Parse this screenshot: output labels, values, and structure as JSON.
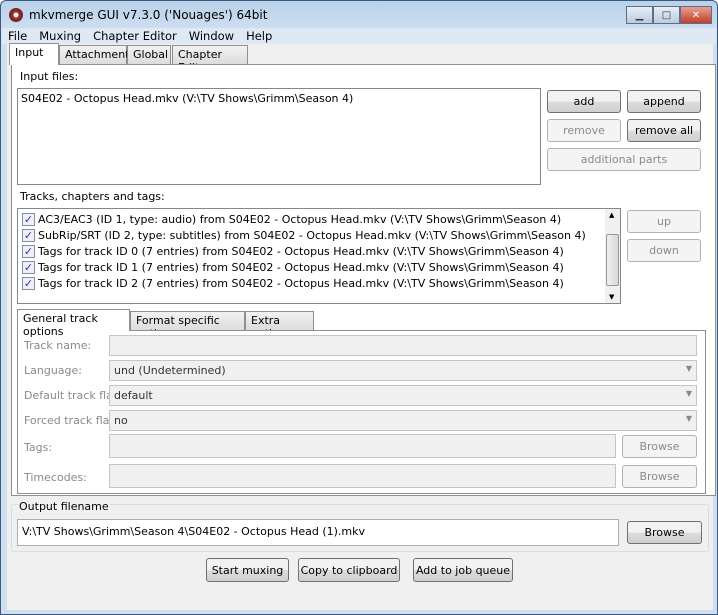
{
  "window": {
    "title": "mkvmerge GUI v7.3.0 ('Nouages') 64bit",
    "minimize": "▁",
    "maximize": "□",
    "close": "✕"
  },
  "menu": [
    "File",
    "Muxing",
    "Chapter Editor",
    "Window",
    "Help"
  ],
  "tabs": [
    "Input",
    "Attachments",
    "Global",
    "Chapter Editor"
  ],
  "input": {
    "input_files_label": "Input files:",
    "files": [
      "S04E02 - Octopus Head.mkv (V:\\TV Shows\\Grimm\\Season 4)"
    ],
    "add": "add",
    "append": "append",
    "remove": "remove",
    "remove_all": "remove all",
    "additional_parts": "additional parts",
    "tracks_label": "Tracks, chapters and tags:",
    "tracks": [
      "AC3/EAC3 (ID 1, type: audio) from S04E02 - Octopus Head.mkv (V:\\TV Shows\\Grimm\\Season 4)",
      "SubRip/SRT (ID 2, type: subtitles) from S04E02 - Octopus Head.mkv (V:\\TV Shows\\Grimm\\Season 4)",
      "Tags for track ID 0 (7 entries) from S04E02 - Octopus Head.mkv (V:\\TV Shows\\Grimm\\Season 4)",
      "Tags for track ID 1 (7 entries) from S04E02 - Octopus Head.mkv (V:\\TV Shows\\Grimm\\Season 4)",
      "Tags for track ID 2 (7 entries) from S04E02 - Octopus Head.mkv (V:\\TV Shows\\Grimm\\Season 4)"
    ],
    "up": "up",
    "down": "down",
    "subtabs": [
      "General track options",
      "Format specific options",
      "Extra options"
    ],
    "track_name_label": "Track name:",
    "track_name": "",
    "language_label": "Language:",
    "language": "und (Undetermined)",
    "default_flag_label": "Default track flag:",
    "default_flag": "default",
    "forced_flag_label": "Forced track flag:",
    "forced_flag": "no",
    "tags_label": "Tags:",
    "tags": "",
    "timecodes_label": "Timecodes:",
    "timecodes": "",
    "browse": "Browse"
  },
  "output": {
    "label": "Output filename",
    "value": "V:\\TV Shows\\Grimm\\Season 4\\S04E02 - Octopus Head (1).mkv",
    "browse": "Browse"
  },
  "actions": {
    "start": "Start muxing",
    "copy": "Copy to clipboard",
    "queue": "Add to job queue"
  }
}
